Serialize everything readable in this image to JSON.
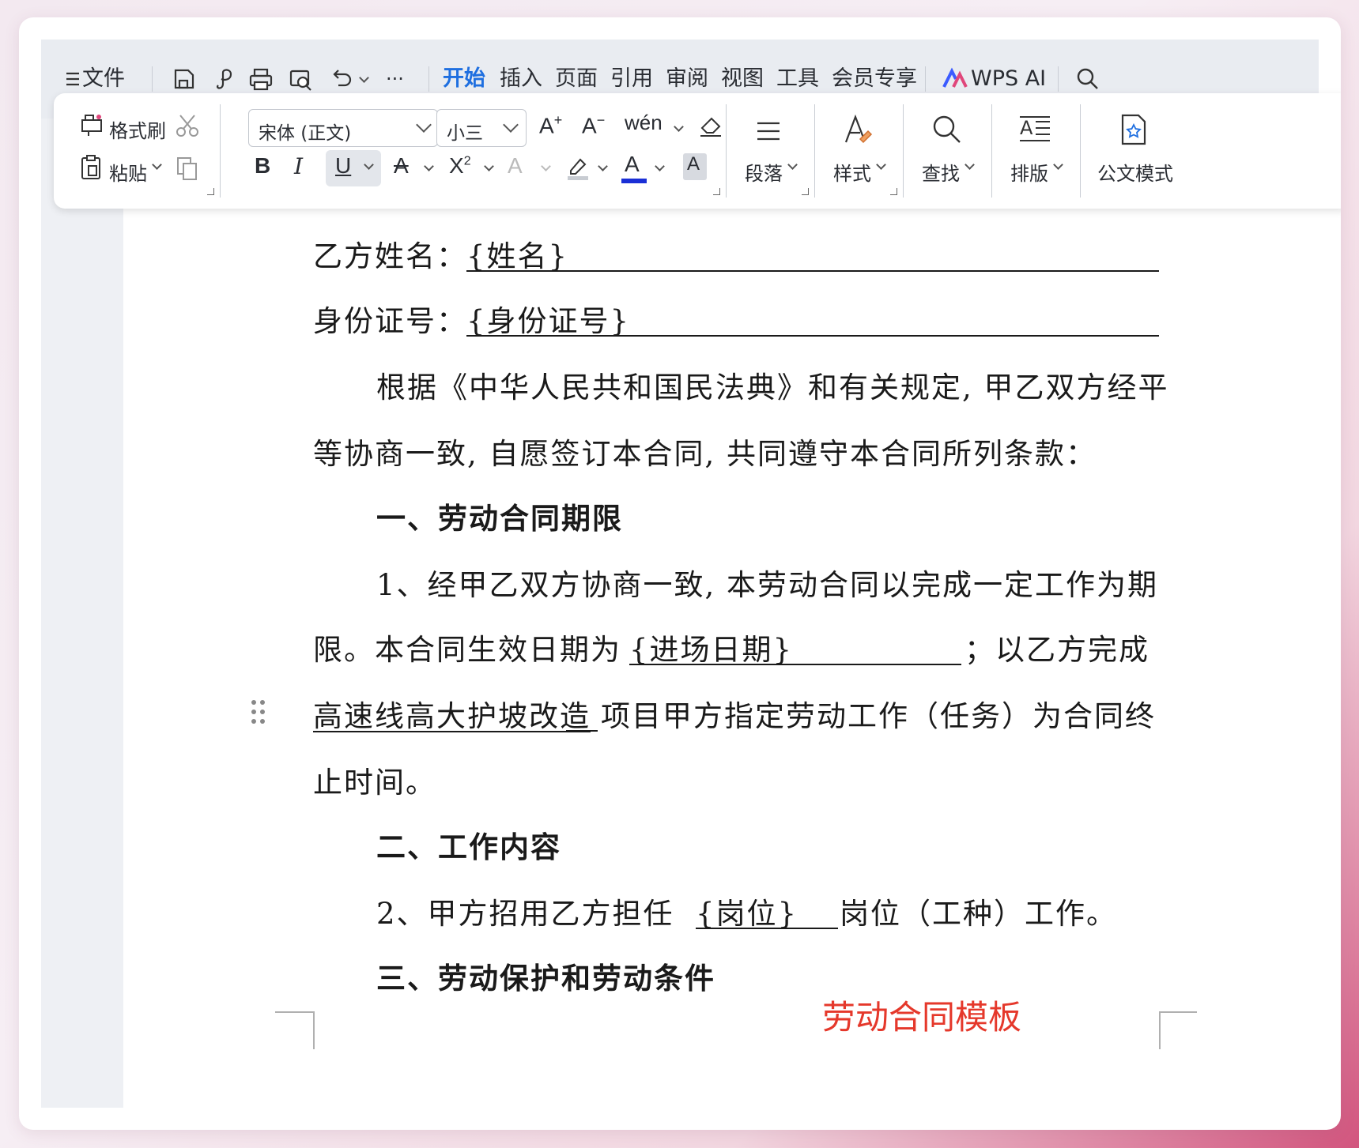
{
  "menubar": {
    "menu_label": "文件",
    "tabs": [
      {
        "label": "开始",
        "active": true
      },
      {
        "label": "插入",
        "active": false
      },
      {
        "label": "页面",
        "active": false
      },
      {
        "label": "引用",
        "active": false
      },
      {
        "label": "审阅",
        "active": false
      },
      {
        "label": "视图",
        "active": false
      },
      {
        "label": "工具",
        "active": false
      },
      {
        "label": "会员专享",
        "active": false
      }
    ],
    "ai_label": "WPS AI",
    "more_label": "···"
  },
  "ribbon": {
    "format_painter": "格式刷",
    "paste": "粘贴",
    "font_name": "宋体 (正文)",
    "font_size": "小三",
    "bold": "B",
    "italic": "I",
    "underline": "U",
    "paragraph": "段落",
    "styles": "样式",
    "find": "查找",
    "layout": "排版",
    "official_doc": "公文模式",
    "accent_color": "#1f6fe0",
    "font_color": "#1a2fd6"
  },
  "document": {
    "party_b_name_label": "乙方姓名：",
    "party_b_name_value": "{姓名}",
    "id_label": "身份证号：",
    "id_value": "{身份证号}",
    "intro_line1": "根据《中华人民共和国民法典》和有关规定, 甲乙双方经平",
    "intro_line2": "等协商一致, 自愿签订本合同, 共同遵守本合同所列条款：",
    "section1_title": "一、劳动合同期限",
    "clause1_line1": "1、经甲乙双方协商一致, 本劳动合同以完成一定工作为期",
    "clause1_line2a": "限。本合同生效日期为",
    "clause1_field": "{进场日期}",
    "clause1_line2b": "；以乙方完成",
    "clause1_project": "高速线高大护坡改造",
    "clause1_line3": "项目甲方指定劳动工作（任务）为合同终",
    "clause1_line4": "止时间。",
    "section2_title": "二、工作内容",
    "clause2a": "2、甲方招用乙方担任",
    "clause2_field": "{岗位}",
    "clause2b": "岗位（工种）工作。",
    "section3_title": "三、劳动保护和劳动条件",
    "watermark": "劳动合同模板",
    "watermark_color": "#e5382b"
  }
}
